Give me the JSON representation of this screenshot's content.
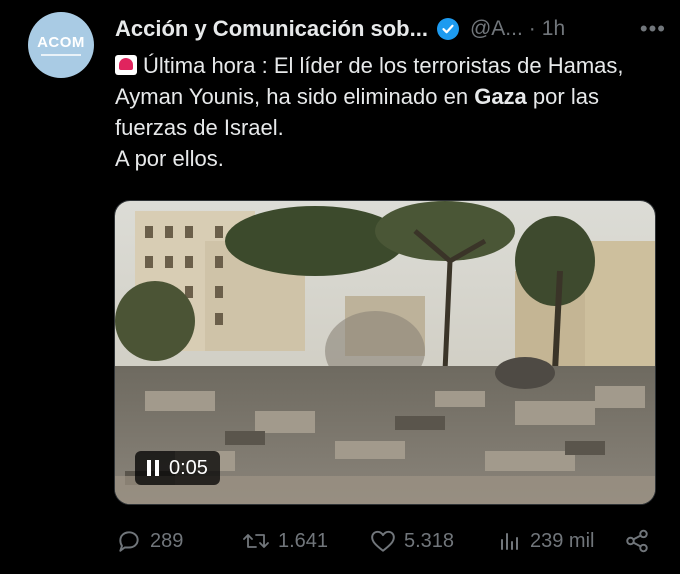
{
  "author": {
    "avatar_text": "ACOM",
    "display_name": "Acción y Comunicación sob...",
    "handle": "@A...",
    "separator": "·",
    "time": "1h",
    "more_label": "•••"
  },
  "tweet": {
    "line1": "Última hora : El líder de los terroristas de Hamas, Ayman Younis, ha sido eliminado en",
    "bold_word": "Gaza",
    "line1_tail": " por las fuerzas de Israel.",
    "line2": "A por ellos."
  },
  "media": {
    "type": "video",
    "elapsed": "0:05"
  },
  "actions": {
    "replies": "289",
    "reposts": "1.641",
    "likes": "5.318",
    "views": "239 mil"
  },
  "colors": {
    "background": "#000000",
    "text": "#e7e9ea",
    "muted": "#71767b",
    "verified": "#1d9bf0",
    "avatar_bg": "#a9cbe4"
  }
}
